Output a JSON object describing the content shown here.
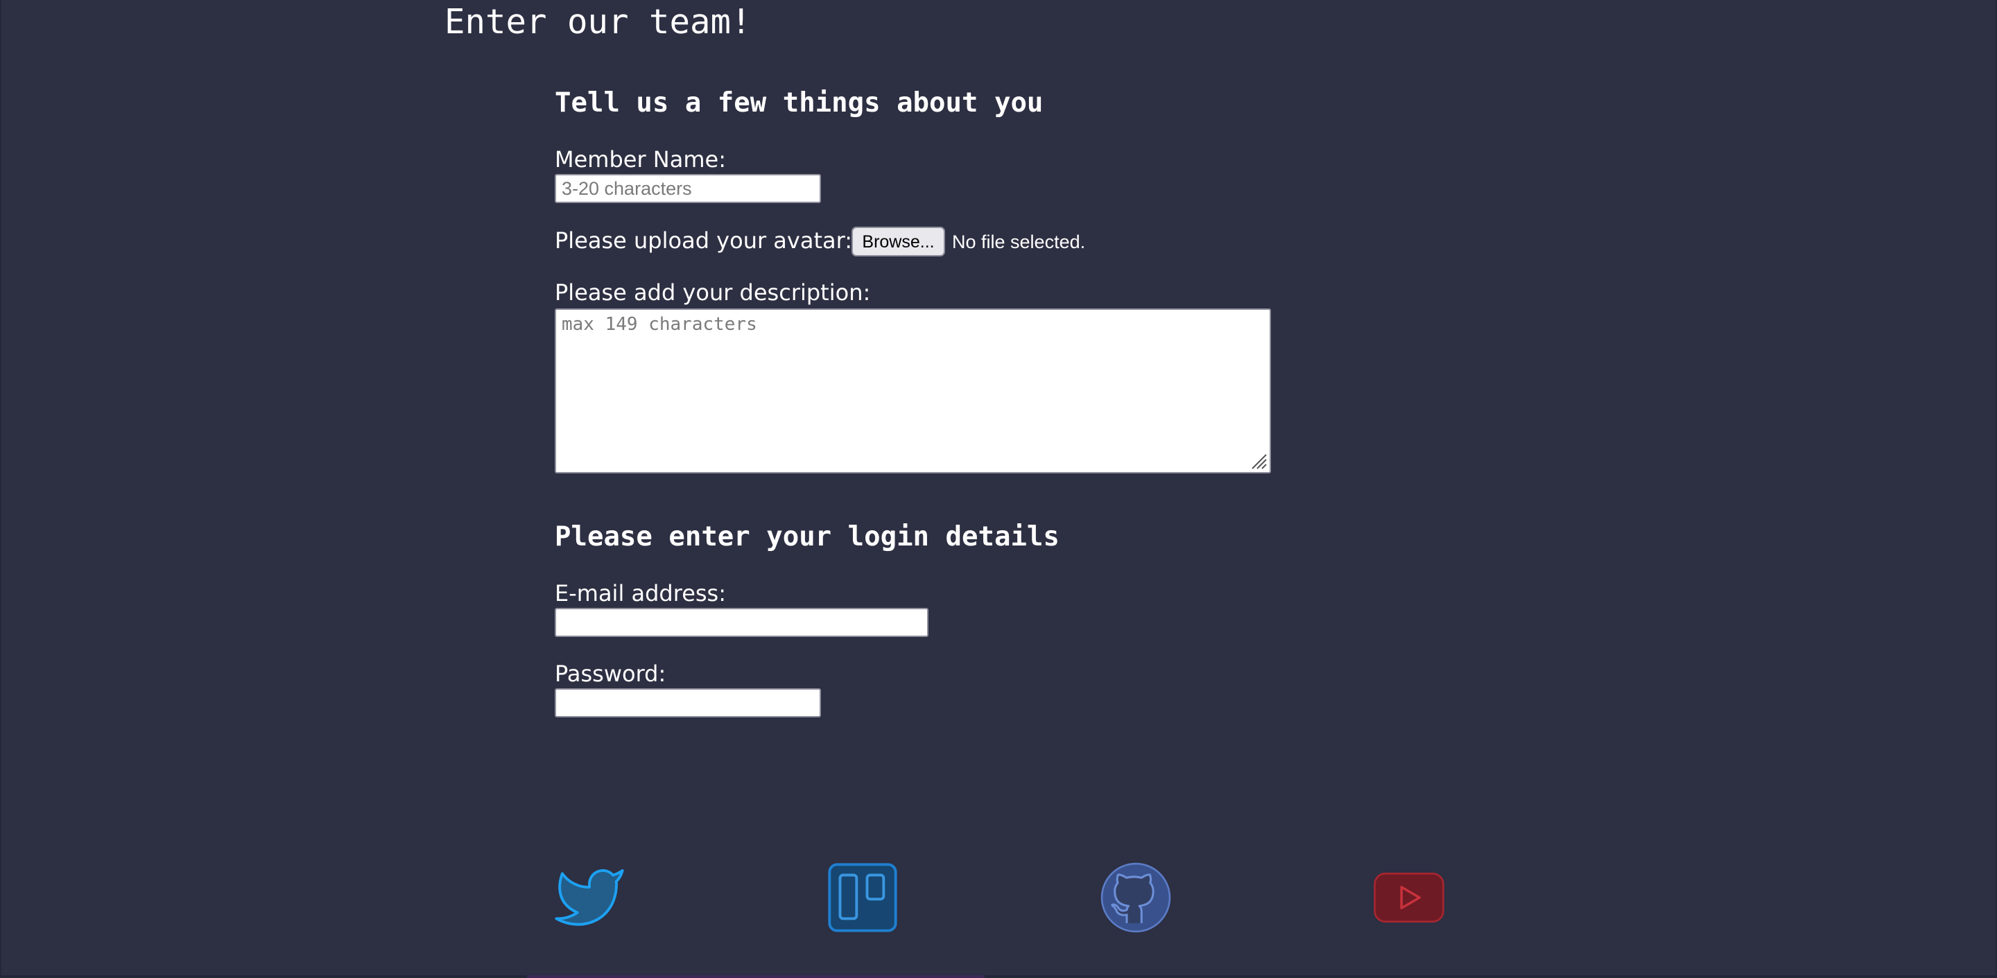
{
  "page": {
    "title": "Enter our team!"
  },
  "about_section": {
    "heading": "Tell us a few things about you",
    "member_name": {
      "label": "Member Name:",
      "placeholder": "3-20 characters",
      "value": ""
    },
    "avatar": {
      "label": "Please upload your avatar:",
      "button_label": "Browse...",
      "status": "No file selected."
    },
    "description": {
      "label": "Please add your description:",
      "placeholder": "max 149 characters",
      "value": ""
    }
  },
  "login_section": {
    "heading": "Please enter your login details",
    "email": {
      "label": "E-mail address:",
      "placeholder": "",
      "value": ""
    },
    "password": {
      "label": "Password:",
      "placeholder": "",
      "value": ""
    }
  },
  "footer": {
    "social_links": [
      {
        "icon": "twitter-icon",
        "color": "#1da1f2"
      },
      {
        "icon": "trello-icon",
        "color": "#0079bf"
      },
      {
        "icon": "github-icon",
        "color": "#4a6bb5"
      },
      {
        "icon": "youtube-icon",
        "color": "#c4302b"
      }
    ]
  },
  "colors": {
    "background": "#2d2f42",
    "text": "#ffffff",
    "input_border": "#8f8f9d"
  }
}
